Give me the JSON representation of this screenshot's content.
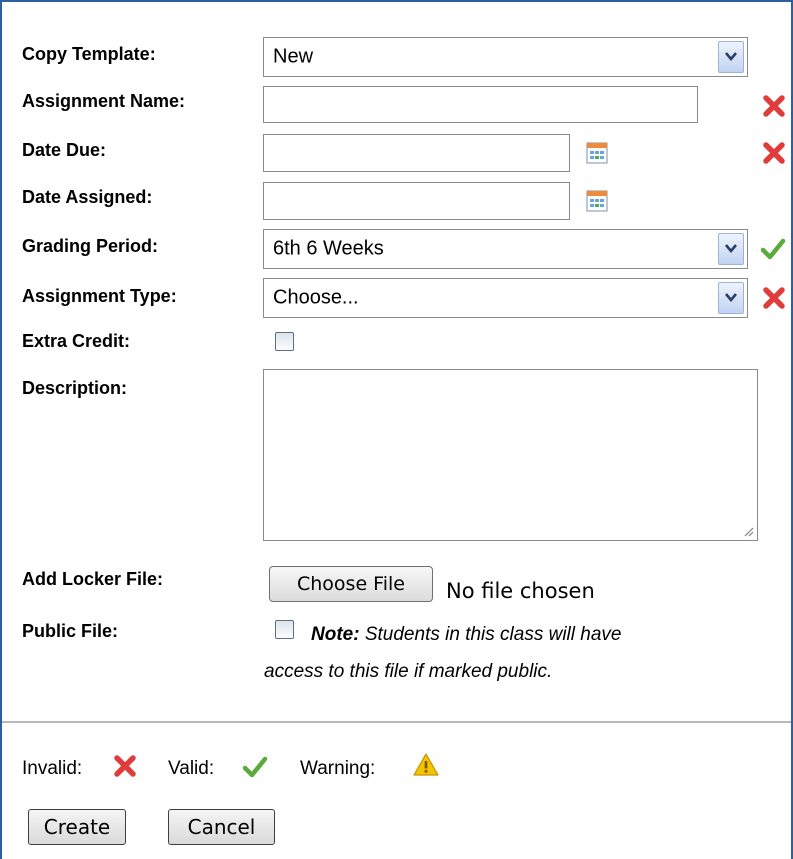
{
  "form": {
    "copy_template": {
      "label": "Copy Template:",
      "value": "New"
    },
    "assignment_name": {
      "label": "Assignment Name:",
      "value": "",
      "status": "invalid"
    },
    "date_due": {
      "label": "Date Due:",
      "value": "",
      "status": "invalid"
    },
    "date_assigned": {
      "label": "Date Assigned:",
      "value": ""
    },
    "grading_period": {
      "label": "Grading Period:",
      "value": "6th 6 Weeks",
      "status": "valid"
    },
    "assignment_type": {
      "label": "Assignment Type:",
      "value": "Choose...",
      "status": "invalid"
    },
    "extra_credit": {
      "label": "Extra Credit:",
      "checked": false
    },
    "description": {
      "label": "Description:",
      "value": ""
    },
    "locker_file": {
      "label": "Add Locker File:",
      "button_label": "Choose File",
      "status_text": "No file chosen"
    },
    "public_file": {
      "label": "Public File:",
      "checked": false,
      "note_bold": "Note:",
      "note_line1": "Students in this class will have",
      "note_line2": "access to this file if marked public."
    }
  },
  "legend": {
    "invalid_label": "Invalid:",
    "valid_label": "Valid:",
    "warning_label": "Warning:"
  },
  "actions": {
    "create_label": "Create",
    "cancel_label": "Cancel"
  },
  "icons": {
    "invalid": "red-x-icon",
    "valid": "green-check-icon",
    "warning": "warning-triangle-icon",
    "calendar": "calendar-icon",
    "dropdown": "chevron-down-icon"
  },
  "colors": {
    "invalid": "#e03c3c",
    "valid": "#5aaa3c",
    "warning": "#f2c500",
    "frame": "#2f5f9e"
  }
}
